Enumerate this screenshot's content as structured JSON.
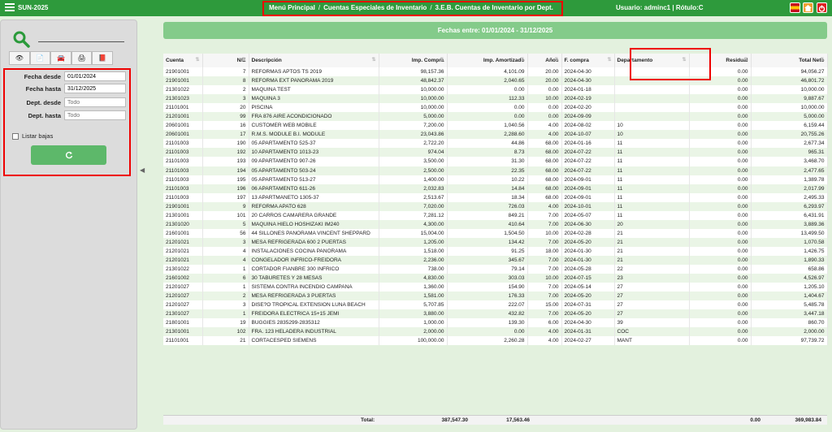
{
  "topbar": {
    "app_name": "SUN-2025",
    "crumb_1": "Menú Principal",
    "crumb_2": "Cuentas Especiales de Inventario",
    "crumb_3": "3.E.B. Cuentas de Inventario por Dept.",
    "separator": "/",
    "user": "Usuario: adminc1 | Rótulo:C",
    "icons": [
      "spain-flag-icon",
      "home-icon",
      "power-icon"
    ],
    "colors": {
      "bar": "#2e9a3c",
      "highlight": "#e00000"
    }
  },
  "sidebar": {
    "toolbar_icons": [
      "view-icon",
      "document-icon",
      "car-icon",
      "printer-icon",
      "pdf-icon"
    ],
    "fields": {
      "fecha_desde_label": "Fecha desde",
      "fecha_desde_value": "01/01/2024",
      "fecha_hasta_label": "Fecha hasta",
      "fecha_hasta_value": "31/12/2025",
      "dept_desde_label": "Dept. desde",
      "dept_desde_placeholder": "Todo",
      "dept_hasta_label": "Dept. hasta",
      "dept_hasta_placeholder": "Todo"
    },
    "listar_bajas_label": "Listar bajas",
    "listar_bajas_checked": false
  },
  "banner": "Fechas entre: 01/01/2024 - 31/12/2025",
  "table": {
    "headers": [
      "Cuenta",
      "N/E",
      "Descripción",
      "Imp. Compra",
      "Imp. Amortizado",
      "Años",
      "F. compra",
      "Departamento",
      "Residual",
      "Total Neto"
    ],
    "rows": [
      [
        "21901001",
        "7",
        "REFORMAS APTOS TS 2019",
        "98,157.36",
        "4,101.09",
        "20.00",
        "2024-04-30",
        "",
        "0.00",
        "94,056.27"
      ],
      [
        "21901001",
        "8",
        "REFORMA EXT PANORAMA 2019",
        "48,842.37",
        "2,040.65",
        "20.00",
        "2024-04-30",
        "",
        "0.00",
        "46,801.72"
      ],
      [
        "21301022",
        "2",
        "MAQUINA TEST",
        "10,000.00",
        "0.00",
        "0.00",
        "2024-01-18",
        "",
        "0.00",
        "10,000.00"
      ],
      [
        "21301023",
        "3",
        "MAQUINA 3",
        "10,000.00",
        "112.33",
        "10.00",
        "2024-02-19",
        "",
        "0.00",
        "9,887.67"
      ],
      [
        "21101001",
        "20",
        "PISCINA",
        "10,000.00",
        "0.00",
        "0.00",
        "2024-02-20",
        "",
        "0.00",
        "10,000.00"
      ],
      [
        "21201001",
        "99",
        "FRA 876 AIRE ACONDICIONADO",
        "5,000.00",
        "0.00",
        "0.00",
        "2024-09-09",
        "",
        "0.00",
        "5,000.00"
      ],
      [
        "20601001",
        "16",
        "CUSTOMER WEB MOBILE",
        "7,200.00",
        "1,040.56",
        "4.00",
        "2024-08-02",
        "10",
        "0.00",
        "6,159.44"
      ],
      [
        "20601001",
        "17",
        "R.M.S. MODULE B.I. MODULE",
        "23,043.86",
        "2,288.60",
        "4.00",
        "2024-10-07",
        "10",
        "0.00",
        "20,755.26"
      ],
      [
        "21101003",
        "190",
        "05 APARTAMENTO 525-37",
        "2,722.20",
        "44.86",
        "68.00",
        "2024-01-16",
        "11",
        "0.00",
        "2,677.34"
      ],
      [
        "21101003",
        "192",
        "10 APARTAMENTO 1013-23",
        "974.04",
        "8.73",
        "68.00",
        "2024-07-22",
        "11",
        "0.00",
        "965.31"
      ],
      [
        "21101003",
        "193",
        "09 APARTAMENTO 907-26",
        "3,500.00",
        "31.30",
        "68.00",
        "2024-07-22",
        "11",
        "0.00",
        "3,468.70"
      ],
      [
        "21101003",
        "194",
        "05 APARTAMENTO 503-24",
        "2,500.00",
        "22.35",
        "68.00",
        "2024-07-22",
        "11",
        "0.00",
        "2,477.65"
      ],
      [
        "21101003",
        "195",
        "05 APARTAMENTO 513-27",
        "1,400.00",
        "10.22",
        "68.00",
        "2024-09-01",
        "11",
        "0.00",
        "1,389.78"
      ],
      [
        "21101003",
        "196",
        "06 APARTAMENTO 611-26",
        "2,032.83",
        "14.84",
        "68.00",
        "2024-09-01",
        "11",
        "0.00",
        "2,017.99"
      ],
      [
        "21101003",
        "197",
        "13 APARTMANETO 1305-37",
        "2,513.67",
        "18.34",
        "68.00",
        "2024-09-01",
        "11",
        "0.00",
        "2,495.33"
      ],
      [
        "21901001",
        "9",
        "REFORMA APATO 628",
        "7,020.00",
        "726.03",
        "4.00",
        "2024-10-01",
        "11",
        "0.00",
        "6,293.97"
      ],
      [
        "21301001",
        "101",
        "20 CARROS CAMARERA GRANDE",
        "7,281.12",
        "849.21",
        "7.00",
        "2024-05-07",
        "11",
        "0.00",
        "6,431.91"
      ],
      [
        "21301020",
        "5",
        "MAQUINA HIELO HOSHIZAKI IM240",
        "4,300.00",
        "410.64",
        "7.00",
        "2024-06-30",
        "20",
        "0.00",
        "3,889.36"
      ],
      [
        "21601001",
        "56",
        "44 SILLONES PANORAMA VINCENT SHEPPARD",
        "15,004.00",
        "1,504.50",
        "10.00",
        "2024-02-28",
        "21",
        "0.00",
        "13,499.50"
      ],
      [
        "21201021",
        "3",
        "MESA REFRIGERADA 600 2 PUERTAS",
        "1,205.00",
        "134.42",
        "7.00",
        "2024-05-20",
        "21",
        "0.00",
        "1,070.58"
      ],
      [
        "21201021",
        "4",
        "INSTALACIONES COCINA PANORAMA",
        "1,518.00",
        "91.25",
        "18.00",
        "2024-01-30",
        "21",
        "0.00",
        "1,426.75"
      ],
      [
        "21201021",
        "4",
        "CONGELADOR INFRICO-FREIDORA",
        "2,236.00",
        "345.67",
        "7.00",
        "2024-01-30",
        "21",
        "0.00",
        "1,890.33"
      ],
      [
        "21301022",
        "1",
        "CORTADOR FIANBRE 300 INFRICO",
        "738.00",
        "79.14",
        "7.00",
        "2024-05-28",
        "22",
        "0.00",
        "658.86"
      ],
      [
        "21601002",
        "6",
        "30 TABURETES Y 28 MESAS",
        "4,830.00",
        "303.03",
        "10.00",
        "2024-07-15",
        "23",
        "0.00",
        "4,526.97"
      ],
      [
        "21201027",
        "1",
        "SISTEMA CONTRA INCENDIO CAMPANA",
        "1,360.00",
        "154.90",
        "7.00",
        "2024-05-14",
        "27",
        "0.00",
        "1,205.10"
      ],
      [
        "21201027",
        "2",
        "MESA REFRIGERADA 3 PUERTAS",
        "1,581.00",
        "176.33",
        "7.00",
        "2024-05-20",
        "27",
        "0.00",
        "1,404.67"
      ],
      [
        "21201027",
        "3",
        "DISE?O TROPICAL EXTENSION LUNA BEACH",
        "5,707.85",
        "222.07",
        "15.00",
        "2024-07-31",
        "27",
        "0.00",
        "5,485.78"
      ],
      [
        "21301027",
        "1",
        "FREIDORA ELECTRICA 15+15 JEMI",
        "3,880.00",
        "432.82",
        "7.00",
        "2024-05-20",
        "27",
        "0.00",
        "3,447.18"
      ],
      [
        "21801001",
        "19",
        "BUGGIES 2835299-2835312",
        "1,000.00",
        "139.30",
        "6.00",
        "2024-04-30",
        "39",
        "0.00",
        "860.70"
      ],
      [
        "21301001",
        "102",
        "FRA. 123 HELADERA INDUSTRIAL",
        "2,000.00",
        "0.00",
        "4.00",
        "2024-01-31",
        "COC",
        "0.00",
        "2,000.00"
      ],
      [
        "21101001",
        "21",
        "CORTACESPED SIEMENS",
        "100,000.00",
        "2,260.28",
        "4.00",
        "2024-02-27",
        "MANT",
        "0.00",
        "97,739.72"
      ]
    ]
  },
  "footer": {
    "total_label": "Total:",
    "imp_compra": "387,547.30",
    "imp_amortizado": "17,563.46",
    "residual": "0.00",
    "total_neto": "369,983.84"
  }
}
